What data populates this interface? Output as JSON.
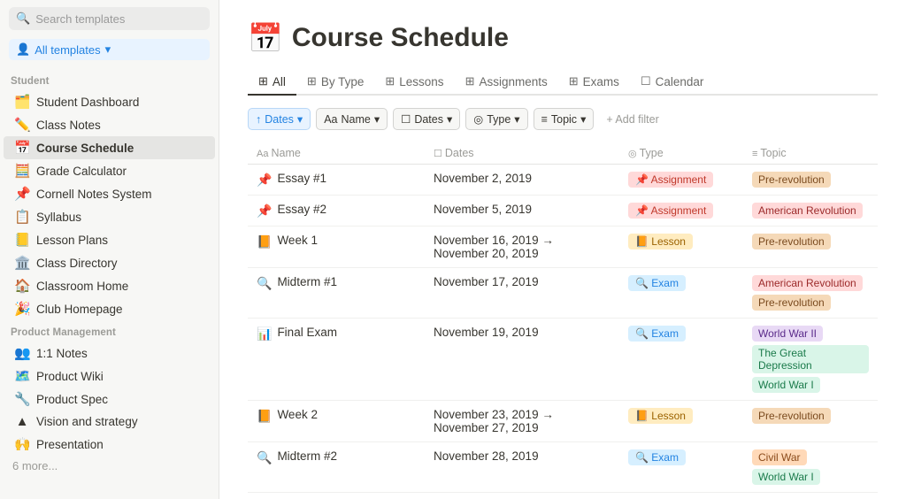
{
  "sidebar": {
    "search_placeholder": "Search templates",
    "all_templates_label": "All templates",
    "sections": [
      {
        "label": "Student",
        "items": [
          {
            "id": "student-dashboard",
            "icon": "🗂️",
            "label": "Student Dashboard",
            "active": false
          },
          {
            "id": "class-notes",
            "icon": "✏️",
            "label": "Class Notes",
            "active": false
          },
          {
            "id": "course-schedule",
            "icon": "📅",
            "label": "Course Schedule",
            "active": true
          },
          {
            "id": "grade-calculator",
            "icon": "🧮",
            "label": "Grade Calculator",
            "active": false
          },
          {
            "id": "cornell-notes",
            "icon": "📌",
            "label": "Cornell Notes System",
            "active": false
          },
          {
            "id": "syllabus",
            "icon": "📋",
            "label": "Syllabus",
            "active": false
          },
          {
            "id": "lesson-plans",
            "icon": "📒",
            "label": "Lesson Plans",
            "active": false
          },
          {
            "id": "class-directory",
            "icon": "🏛️",
            "label": "Class Directory",
            "active": false
          },
          {
            "id": "classroom-home",
            "icon": "🏠",
            "label": "Classroom Home",
            "active": false
          },
          {
            "id": "club-homepage",
            "icon": "🎉",
            "label": "Club Homepage",
            "active": false
          }
        ]
      },
      {
        "label": "Product Management",
        "items": [
          {
            "id": "1on1-notes",
            "icon": "👥",
            "label": "1:1 Notes",
            "active": false
          },
          {
            "id": "product-wiki",
            "icon": "🗺️",
            "label": "Product Wiki",
            "active": false
          },
          {
            "id": "product-spec",
            "icon": "🔧",
            "label": "Product Spec",
            "active": false
          },
          {
            "id": "vision-strategy",
            "icon": "▲",
            "label": "Vision and strategy",
            "active": false
          },
          {
            "id": "presentation",
            "icon": "🙌",
            "label": "Presentation",
            "active": false
          }
        ]
      }
    ],
    "more_label": "6 more..."
  },
  "page": {
    "icon": "📅",
    "title": "Course Schedule"
  },
  "tabs": [
    {
      "id": "all",
      "label": "All",
      "icon": "⊞",
      "active": true
    },
    {
      "id": "by-type",
      "label": "By Type",
      "icon": "⊞",
      "active": false
    },
    {
      "id": "lessons",
      "label": "Lessons",
      "icon": "⊞",
      "active": false
    },
    {
      "id": "assignments",
      "label": "Assignments",
      "icon": "⊞",
      "active": false
    },
    {
      "id": "exams",
      "label": "Exams",
      "icon": "⊞",
      "active": false
    },
    {
      "id": "calendar",
      "label": "Calendar",
      "icon": "☐",
      "active": false
    }
  ],
  "filters": [
    {
      "id": "dates-sort",
      "label": "Dates",
      "icon": "↑",
      "active": true
    },
    {
      "id": "name-filter",
      "label": "Name",
      "icon": "Aa",
      "active": false
    },
    {
      "id": "dates-filter",
      "label": "Dates",
      "icon": "☐",
      "active": false
    },
    {
      "id": "type-filter",
      "label": "Type",
      "icon": "◎",
      "active": false
    },
    {
      "id": "topic-filter",
      "label": "Topic",
      "icon": "≡",
      "active": false
    }
  ],
  "add_filter_label": "+ Add filter",
  "table": {
    "columns": [
      {
        "id": "name",
        "label": "Name",
        "icon": "Aa"
      },
      {
        "id": "dates",
        "label": "Dates",
        "icon": "☐"
      },
      {
        "id": "type",
        "label": "Type",
        "icon": "◎"
      },
      {
        "id": "topic",
        "label": "Topic",
        "icon": "≡"
      }
    ],
    "rows": [
      {
        "id": "essay1",
        "icon": "📌",
        "name": "Essay #1",
        "dates": "November 2, 2019",
        "type": "Assignment",
        "type_class": "badge-assignment",
        "type_icon": "📌",
        "topics": [
          {
            "label": "Pre-revolution",
            "class": "tag-prerevolution"
          }
        ]
      },
      {
        "id": "essay2",
        "icon": "📌",
        "name": "Essay #2",
        "dates": "November 5, 2019",
        "type": "Assignment",
        "type_class": "badge-assignment",
        "type_icon": "📌",
        "topics": [
          {
            "label": "American Revolution",
            "class": "tag-american-revolution"
          }
        ]
      },
      {
        "id": "week1",
        "icon": "📙",
        "name": "Week 1",
        "dates": "November 16, 2019 → November 20, 2019",
        "type": "Lesson",
        "type_class": "badge-lesson",
        "type_icon": "📙",
        "topics": [
          {
            "label": "Pre-revolution",
            "class": "tag-prerevolution"
          }
        ]
      },
      {
        "id": "midterm1",
        "icon": "🔍",
        "name": "Midterm #1",
        "dates": "November 17, 2019",
        "type": "Exam",
        "type_class": "badge-exam",
        "type_icon": "🔍",
        "topics": [
          {
            "label": "American Revolution",
            "class": "tag-american-revolution"
          },
          {
            "label": "Pre-revolution",
            "class": "tag-prerevolution"
          }
        ]
      },
      {
        "id": "final-exam",
        "icon": "📊",
        "name": "Final Exam",
        "dates": "November 19, 2019",
        "type": "Exam",
        "type_class": "badge-exam",
        "type_icon": "🔍",
        "topics": [
          {
            "label": "World War II",
            "class": "tag-world-war-ii"
          },
          {
            "label": "The Great Depression",
            "class": "tag-great-depression"
          },
          {
            "label": "World War I",
            "class": "tag-world-war-i"
          }
        ]
      },
      {
        "id": "week2",
        "icon": "📙",
        "name": "Week 2",
        "dates": "November 23, 2019 → November 27, 2019",
        "type": "Lesson",
        "type_class": "badge-lesson",
        "type_icon": "📙",
        "topics": [
          {
            "label": "Pre-revolution",
            "class": "tag-prerevolution"
          }
        ]
      },
      {
        "id": "midterm2",
        "icon": "🔍",
        "name": "Midterm #2",
        "dates": "November 28, 2019",
        "type": "Exam",
        "type_class": "badge-exam",
        "type_icon": "🔍",
        "topics": [
          {
            "label": "Civil War",
            "class": "tag-civil-war"
          },
          {
            "label": "World War I",
            "class": "tag-world-war-i"
          }
        ]
      }
    ]
  }
}
